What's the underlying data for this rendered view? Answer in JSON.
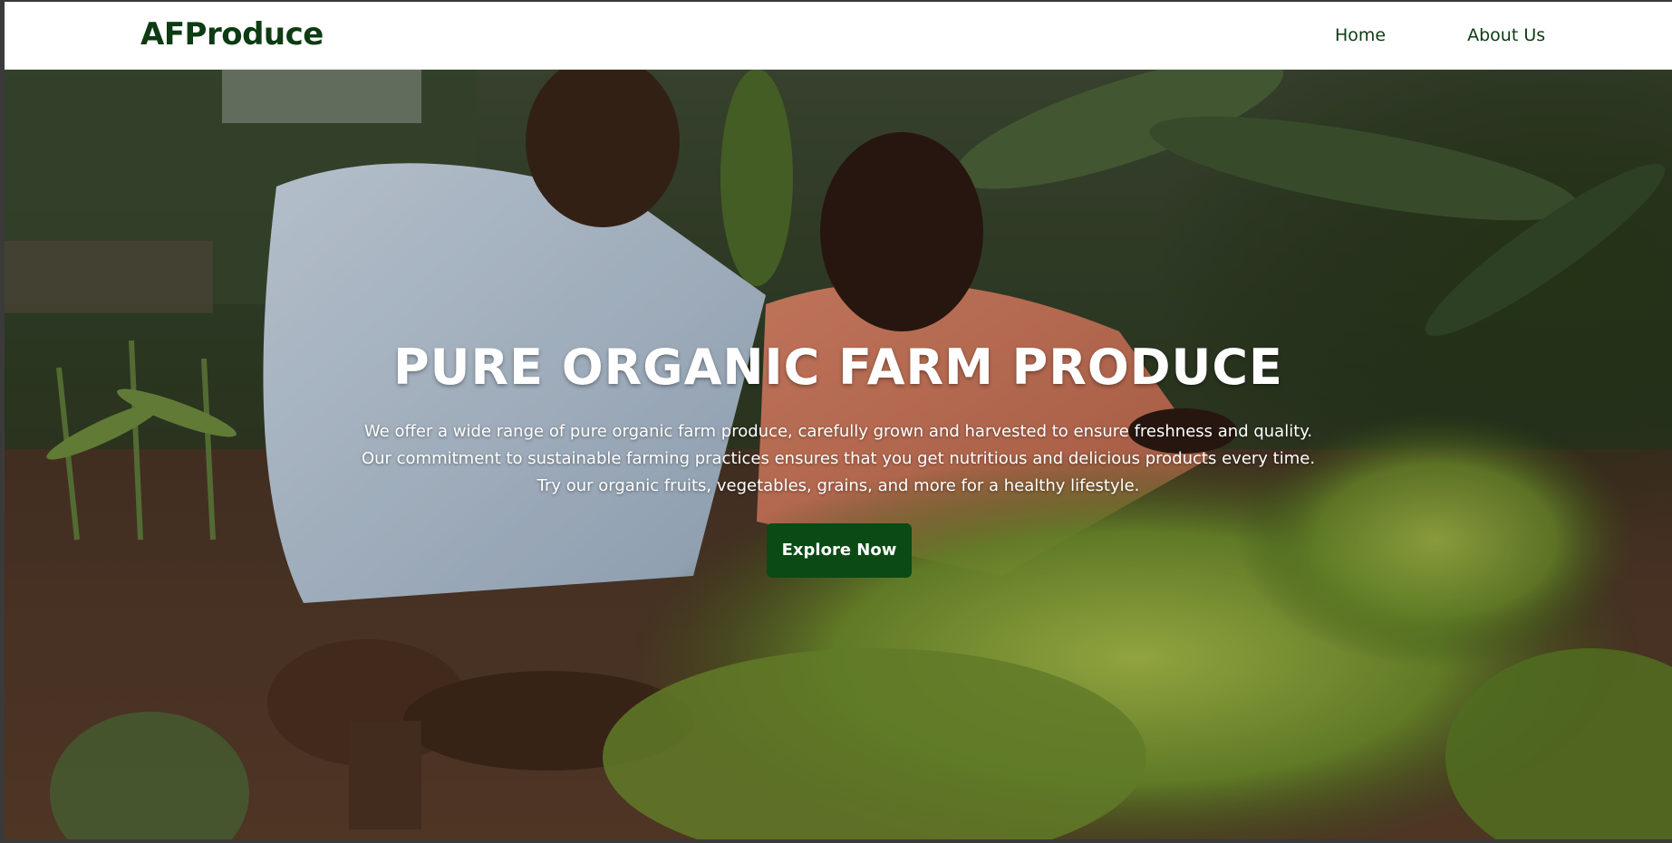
{
  "brand": {
    "name": "AFProduce",
    "color": "#0d3b12"
  },
  "nav": {
    "items": [
      {
        "label": "Home"
      },
      {
        "label": "About Us"
      }
    ]
  },
  "hero": {
    "title": "PURE ORGANIC FARM PRODUCE",
    "lines": [
      "We offer a wide range of pure organic farm produce, carefully grown and harvested to ensure freshness and quality.",
      "Our commitment to sustainable farming practices ensures that you get nutritious and delicious products every time.",
      "Try our organic fruits, vegetables, grains, and more for a healthy lifestyle."
    ],
    "cta_label": "Explore Now",
    "cta_color": "#0b4a14",
    "background_icon": "farmers-in-garden-photo"
  }
}
